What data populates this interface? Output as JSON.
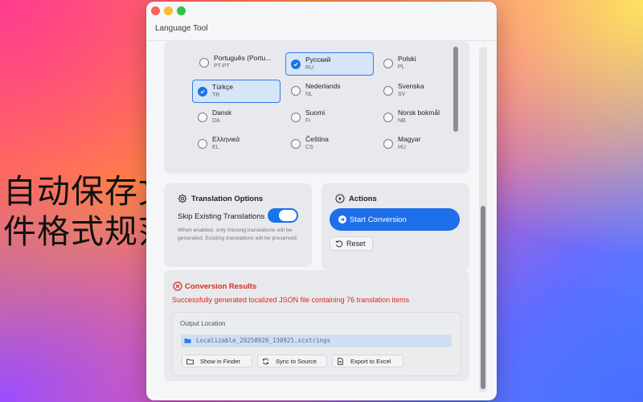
{
  "overlay": {
    "line1": "自动保存文",
    "line2": "件格式规范"
  },
  "window": {
    "title": "Language Tool"
  },
  "languages": [
    {
      "name": "Português (Portu...",
      "code": "PT-PT",
      "selected": false
    },
    {
      "name": "Русский",
      "code": "RU",
      "selected": true
    },
    {
      "name": "Polski",
      "code": "PL",
      "selected": false
    },
    {
      "name": "Türkçe",
      "code": "TR",
      "selected": true
    },
    {
      "name": "Nederlands",
      "code": "NL",
      "selected": false
    },
    {
      "name": "Svenska",
      "code": "SV",
      "selected": false
    },
    {
      "name": "Dansk",
      "code": "DA",
      "selected": false
    },
    {
      "name": "Suomi",
      "code": "FI",
      "selected": false
    },
    {
      "name": "Norsk bokmål",
      "code": "NB",
      "selected": false
    },
    {
      "name": "Ελληνικά",
      "code": "EL",
      "selected": false
    },
    {
      "name": "Čeština",
      "code": "CS",
      "selected": false
    },
    {
      "name": "Magyar",
      "code": "HU",
      "selected": false
    }
  ],
  "options": {
    "title": "Translation Options",
    "skip_label": "Skip Existing Translations",
    "skip_enabled": true,
    "skip_description": "When enabled, only missing translations will be generated. Existing translations will be preserved."
  },
  "actions": {
    "title": "Actions",
    "start_label": "Start Conversion",
    "reset_label": "Reset"
  },
  "results": {
    "title": "Conversion Results",
    "message": "Successfully generated localized JSON file containing 76 translation items",
    "output_label": "Output Location",
    "file_name": "Localizable_20250920_130921.xcstrings",
    "buttons": {
      "finder": "Show in Finder",
      "sync": "Sync to Source",
      "excel": "Export to Excel"
    }
  },
  "colors": {
    "accent": "#1a73e8",
    "error": "#d42c24"
  }
}
